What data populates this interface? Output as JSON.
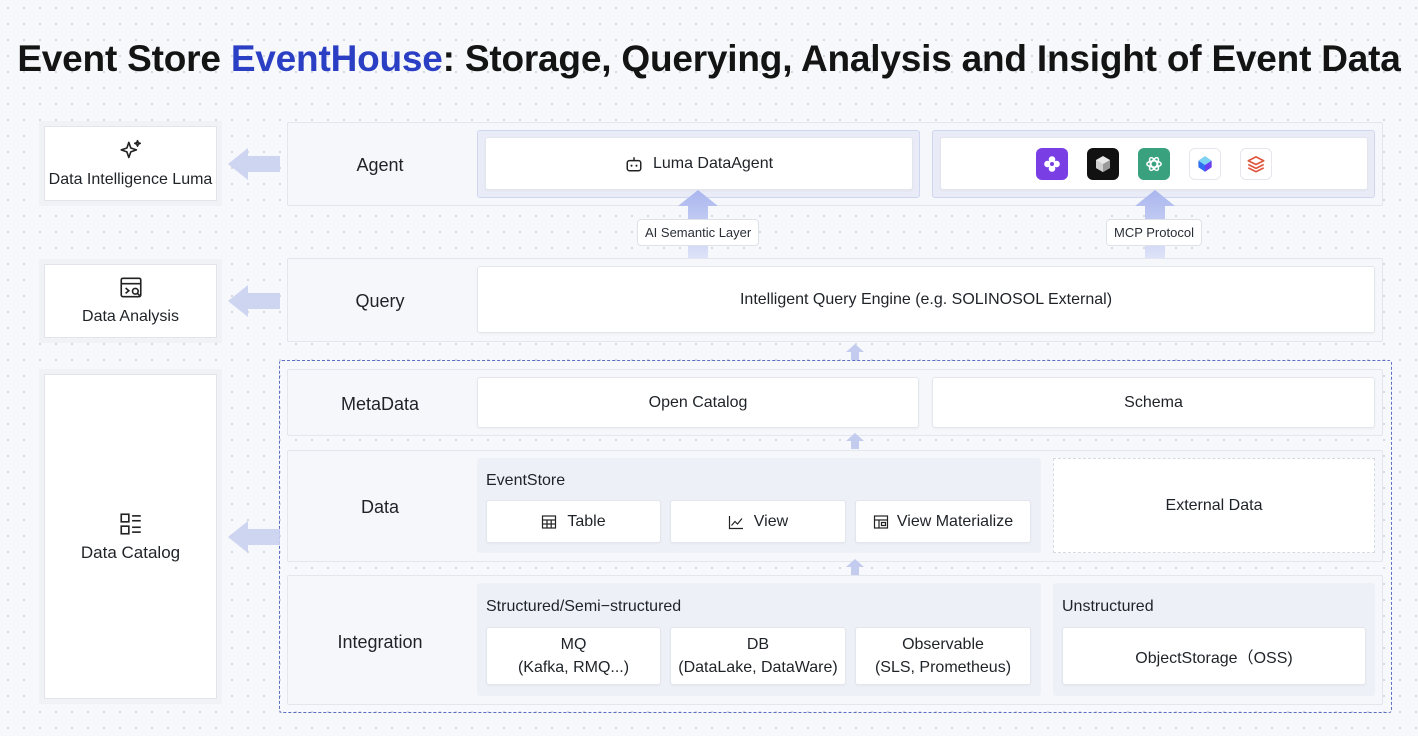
{
  "title": {
    "prefix": "Event Store ",
    "brand": "EventHouse",
    "suffix": ": Storage, Querying, Analysis and Insight of Event Data"
  },
  "left_cards": {
    "luma": "Data Intelligence Luma",
    "analysis": "Data Analysis",
    "catalog": "Data Catalog"
  },
  "rows": {
    "agent": {
      "label": "Agent",
      "agent_box": "Luma DataAgent",
      "logos": [
        "purple-flower-logo",
        "black-cube-logo",
        "green-openai-logo",
        "blue-gem-logo",
        "red-stack-logo"
      ]
    },
    "connectors": {
      "semantic": "AI Semantic Layer",
      "mcp": "MCP Protocol"
    },
    "query": {
      "label": "Query",
      "engine": "Intelligent Query Engine (e.g. SOLINOSOL External)"
    },
    "metadata": {
      "label": "MetaData",
      "open_catalog": "Open Catalog",
      "schema": "Schema"
    },
    "data": {
      "label": "Data",
      "eventstore": "EventStore",
      "table": "Table",
      "view": "View",
      "view_materialize": "View Materialize",
      "external": "External Data"
    },
    "integration": {
      "label": "Integration",
      "structured_title": "Structured/Semi−structured",
      "mq_line1": "MQ",
      "mq_line2": "(Kafka, RMQ...)",
      "db_line1": "DB",
      "db_line2": "(DataLake, DataWare)",
      "obs_line1": "Observable",
      "obs_line2": "(SLS, Prometheus)",
      "unstructured_title": "Unstructured",
      "object_storage": "ObjectStorage（OSS)"
    }
  },
  "colors": {
    "brand": "#2b3fc4",
    "frame_dash": "#5d6fc2",
    "arrow": "#c3cbef"
  }
}
